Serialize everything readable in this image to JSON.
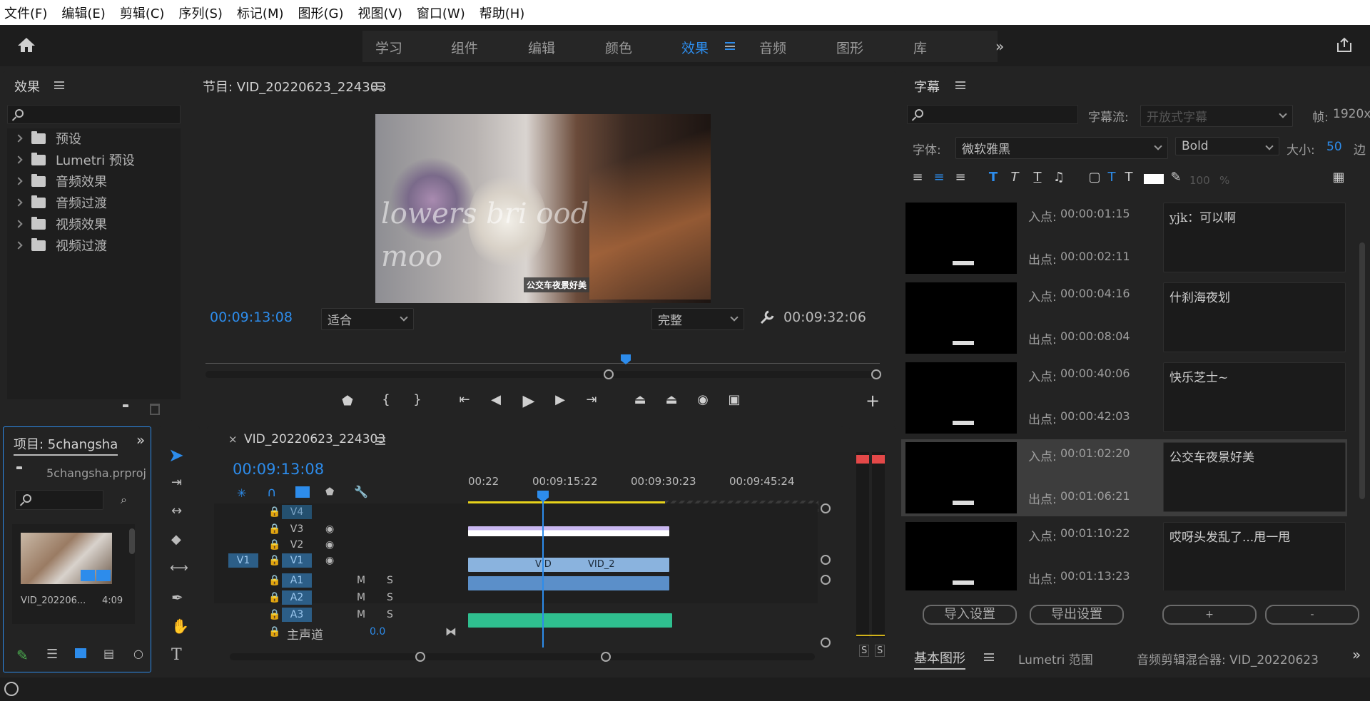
{
  "menu": [
    "文件(F)",
    "编辑(E)",
    "剪辑(C)",
    "序列(S)",
    "标记(M)",
    "图形(G)",
    "视图(V)",
    "窗口(W)",
    "帮助(H)"
  ],
  "workspaces": [
    "学习",
    "组件",
    "编辑",
    "颜色",
    "效果",
    "音频",
    "图形",
    "库"
  ],
  "active_workspace": "效果",
  "effects_panel": {
    "title": "效果",
    "items": [
      "预设",
      "Lumetri 预设",
      "音频效果",
      "音频过渡",
      "视频效果",
      "视频过渡"
    ]
  },
  "program_monitor": {
    "title": "节目: VID_20220623_224303",
    "timecode": "00:09:13:08",
    "duration": "00:09:32:06",
    "fit": "适合",
    "quality": "完整",
    "subtitle": "公交车夜景好美",
    "frame_text": "lowers bri ood moo"
  },
  "captions_panel": {
    "title": "字幕",
    "stream_label": "字幕流:",
    "stream_value": "开放式字幕",
    "frame_label": "帧:",
    "frame_value": "1920x",
    "font_label": "字体:",
    "font_value": "微软雅黑",
    "style_value": "Bold",
    "size_label": "大小:",
    "size_value": "50",
    "edge_label": "边",
    "opacity": "100",
    "opacity_unit": "%",
    "in_label": "入点:",
    "out_label": "出点:",
    "rows": [
      {
        "in": "00:00:01:15",
        "out": "00:00:02:11",
        "text": "yjk：可以啊"
      },
      {
        "in": "00:00:04:16",
        "out": "00:00:08:04",
        "text": "什刹海夜划"
      },
      {
        "in": "00:00:40:06",
        "out": "00:00:42:03",
        "text": "快乐芝士~"
      },
      {
        "in": "00:01:02:20",
        "out": "00:01:06:21",
        "text": "公交车夜景好美"
      },
      {
        "in": "00:01:10:22",
        "out": "00:01:13:23",
        "text": "哎呀头发乱了...甩一甩"
      }
    ],
    "import_label": "导入设置",
    "export_label": "导出设置",
    "add_label": "+",
    "remove_label": "-"
  },
  "bottom_right_tabs": [
    "基本图形",
    "Lumetri 范围",
    "音频剪辑混合器: VID_20220623"
  ],
  "project_panel": {
    "title": "项目: 5changsha",
    "file": "5changsha.prproj",
    "clip_name": "VID_2022062...",
    "clip_name_short": "VID_202206...",
    "clip_duration": "4:09"
  },
  "timeline": {
    "title": "VID_20220623_224303",
    "close": "×",
    "timecode": "00:09:13:08",
    "ruler": [
      "00:22",
      "00:09:15:22",
      "00:09:30:23",
      "00:09:45:24"
    ],
    "tracks": [
      "V4",
      "V3",
      "V2",
      "V1",
      "A1",
      "A2",
      "A3"
    ],
    "source_v1": "V1",
    "mute": "M",
    "solo": "S",
    "master_label": "主声道",
    "master_value": "0.0",
    "clip_labels": [
      "VID",
      "VID_2"
    ]
  },
  "meter_labels": [
    "S",
    "S"
  ],
  "colors": {
    "accent": "#2d8ceb",
    "clip_video": "#8ab3de",
    "clip_audio": "#5b8fc9",
    "clip_a3": "#2fbf8f",
    "clip_v3": "#b9a7e4"
  }
}
